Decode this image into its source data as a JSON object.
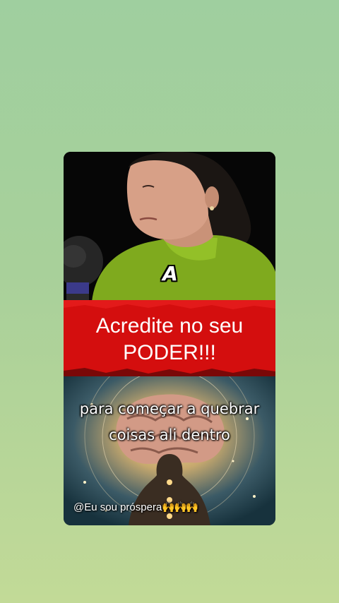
{
  "video": {
    "caption_letter": "A",
    "banner_line1": "Acredite no seu",
    "banner_line2": "PODER!!!",
    "overlay_line1": "para começar a quebrar",
    "overlay_line2": "coisas ali dentro",
    "handle": "@Eu sou próspera",
    "handle_emoji": "🙌🙌🙌",
    "colors": {
      "banner_red": "#d40e0e",
      "sweater_green": "#7faa1e"
    }
  }
}
